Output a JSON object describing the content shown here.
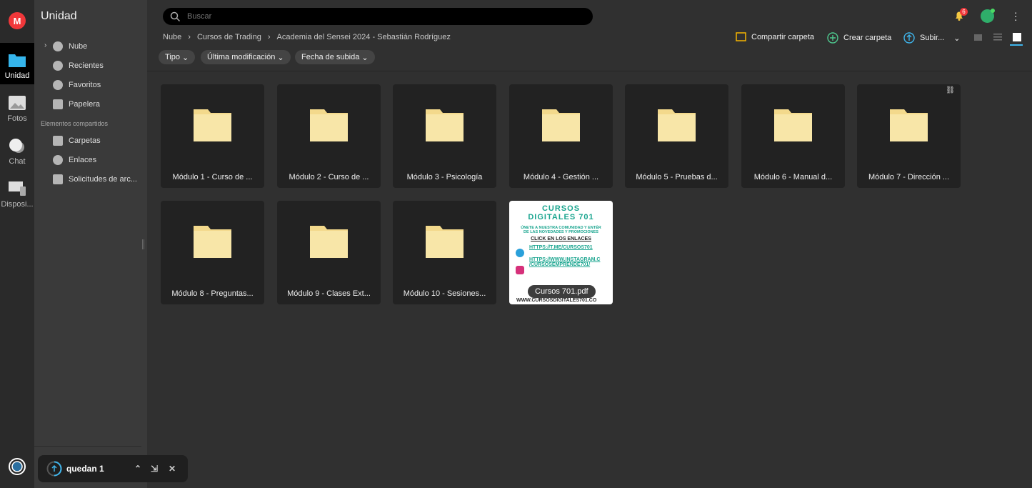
{
  "rail": {
    "logo": "M",
    "items": [
      {
        "label": "Unidad",
        "icon": "folder-icon"
      },
      {
        "label": "Fotos",
        "icon": "photo-icon"
      },
      {
        "label": "Chat",
        "icon": "chat-icon"
      },
      {
        "label": "Disposi...",
        "icon": "devices-icon"
      }
    ]
  },
  "sidebar": {
    "title": "Unidad",
    "items": [
      {
        "label": "Nube",
        "icon": "cloud-icon"
      },
      {
        "label": "Recientes",
        "icon": "clock-icon"
      },
      {
        "label": "Favoritos",
        "icon": "heart-icon"
      },
      {
        "label": "Papelera",
        "icon": "trash-icon"
      }
    ],
    "shared_section": "Elementos compartidos",
    "shared_items": [
      {
        "label": "Carpetas",
        "icon": "shared-folder-icon"
      },
      {
        "label": "Enlaces",
        "icon": "link-icon"
      },
      {
        "label": "Solicitudes de arc...",
        "icon": "file-request-icon"
      }
    ]
  },
  "search": {
    "placeholder": "Buscar"
  },
  "header": {
    "notification_count": "6"
  },
  "breadcrumb": [
    "Nube",
    "Cursos de Trading",
    "Academia del Sensei 2024 - Sebastián Rodríguez"
  ],
  "filters": [
    "Tipo",
    "Última modificación",
    "Fecha de subida"
  ],
  "actions": {
    "share": "Compartir carpeta",
    "create": "Crear carpeta",
    "upload": "Subir..."
  },
  "items": [
    {
      "name": "Módulo 1 - Curso de ...",
      "type": "folder"
    },
    {
      "name": "Módulo 2 - Curso de ...",
      "type": "folder"
    },
    {
      "name": "Módulo 3 - Psicología",
      "type": "folder"
    },
    {
      "name": "Módulo 4 - Gestión ...",
      "type": "folder"
    },
    {
      "name": "Módulo 5 - Pruebas d...",
      "type": "folder"
    },
    {
      "name": "Módulo 6 - Manual d...",
      "type": "folder"
    },
    {
      "name": "Módulo 7 - Dirección ...",
      "type": "folder",
      "linked": true
    },
    {
      "name": "Módulo 8 - Preguntas...",
      "type": "folder"
    },
    {
      "name": "Módulo 9 - Clases Ext...",
      "type": "folder"
    },
    {
      "name": "Módulo 10 - Sesiones...",
      "type": "folder"
    },
    {
      "name": "Cursos 701.pdf",
      "type": "pdf"
    }
  ],
  "pdf_preview": {
    "title1": "CURSOS",
    "title2": "DIGITALES 701",
    "line1": "ÚNETE A NUESTRA COMUNIDAD Y ENTÉR",
    "line2": "DE LAS NOVEDADES Y PROMOCIONES",
    "cta": "CLICK EN LOS ENLACES",
    "telegram": "HTTPS://T.ME/CURSOS701",
    "instagram1": "HTTPS://WWW.INSTAGRAM.C",
    "instagram2": "/CURSOSEMPRENDE701/",
    "web": "WWW.CURSOSDIGITALES701.CO"
  },
  "toast": {
    "label": "quedan 1"
  }
}
